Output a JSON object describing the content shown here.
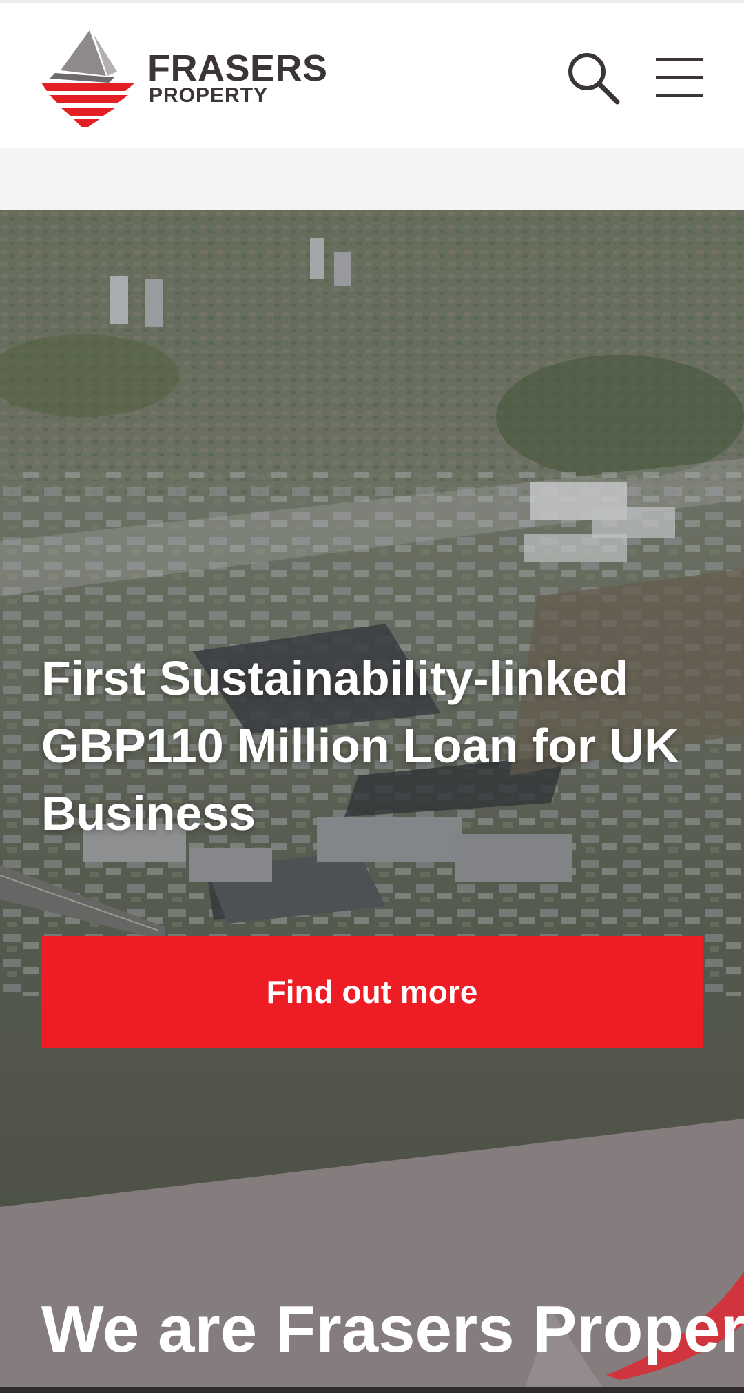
{
  "brand": {
    "name": "FRASERS",
    "subname": "PROPERTY",
    "accent_red": "#ee1c25",
    "text_dark": "#3b3536"
  },
  "header": {
    "icons": [
      "search-icon",
      "hamburger-menu-icon"
    ]
  },
  "hero": {
    "title": "First Sustainability-linked GBP110 Million Loan for UK Business",
    "cta_label": "Find out more",
    "background": "aerial-photo-industrial-estate"
  },
  "about": {
    "title": "We are Frasers Property. A",
    "panel_color": "#857c7d"
  }
}
